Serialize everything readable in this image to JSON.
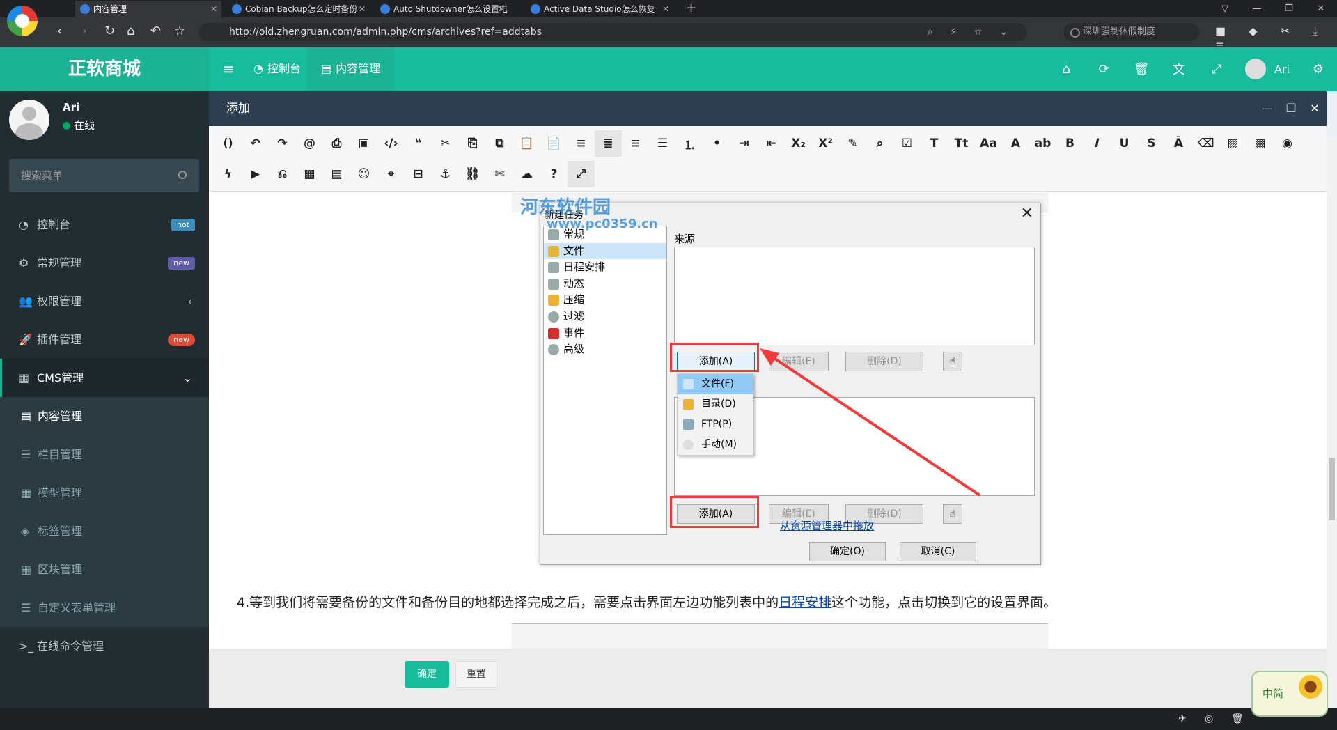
{
  "browser": {
    "tabs": [
      {
        "title": "内容管理",
        "active": true
      },
      {
        "title": "Cobian Backup怎么定时备份",
        "active": false
      },
      {
        "title": "Auto Shutdowner怎么设置电",
        "active": false
      },
      {
        "title": "Active Data Studio怎么恢复",
        "active": false
      }
    ],
    "url": "http://old.zhengruan.com/admin.php/cms/archives?ref=addtabs",
    "search_placeholder": "深圳强制休假制度"
  },
  "app": {
    "brand": "正软商城",
    "topnav": [
      {
        "label": "控制台",
        "icon": "dashboard-icon"
      },
      {
        "label": "内容管理",
        "icon": "file-icon"
      }
    ],
    "user_name": "Ari",
    "user_status": "在线",
    "search_placeholder": "搜索菜单"
  },
  "menu": [
    {
      "label": "控制台",
      "icon": "dashboard-icon",
      "badge": "hot",
      "badge_color": "#3c8dbc"
    },
    {
      "label": "常规管理",
      "icon": "cogs-icon",
      "badge": "new",
      "badge_color": "#605ca8"
    },
    {
      "label": "权限管理",
      "icon": "users-icon",
      "chevron": "‹"
    },
    {
      "label": "插件管理",
      "icon": "rocket-icon",
      "badge": "new",
      "badge_color": "#dd4b39"
    },
    {
      "label": "CMS管理",
      "icon": "table-icon",
      "chevron": "⌄"
    }
  ],
  "submenu": [
    {
      "label": "内容管理",
      "icon": "file-icon",
      "active": true
    },
    {
      "label": "栏目管理",
      "icon": "list-icon"
    },
    {
      "label": "模型管理",
      "icon": "grid-icon"
    },
    {
      "label": "标签管理",
      "icon": "tags-icon"
    },
    {
      "label": "区块管理",
      "icon": "grid-icon"
    },
    {
      "label": "自定义表单管理",
      "icon": "list-icon"
    }
  ],
  "menu_after": {
    "label": "在线命令管理",
    "icon": "terminal-icon"
  },
  "dialog": {
    "title": "添加",
    "ok_label": "确定",
    "reset_label": "重置"
  },
  "screenshot": {
    "watermark": "河东软件园",
    "watermark_url": "www.pc0359.cn",
    "window_title": "新建任务",
    "tree": [
      "常规",
      "文件",
      "日程安排",
      "动态",
      "压缩",
      "过滤",
      "事件",
      "高级"
    ],
    "source_label": "来源",
    "add_btn": "添加(A)",
    "edit_btn": "编辑(E)",
    "delete_btn": "删除(D)",
    "context_menu": [
      "文件(F)",
      "目录(D)",
      "FTP(P)",
      "手动(M)"
    ],
    "drag_link": "从资源管理器中拖放",
    "ok_btn": "确定(O)",
    "cancel_btn": "取消(C)"
  },
  "paragraph": {
    "before": "4.等到我们将需要备份的文件和备份目的地都选择完成之后，需要点击界面左边功能列表中的",
    "link": "日程安排",
    "after": "这个功能，点击切换到它的设置界面。"
  },
  "sticker": "中简"
}
